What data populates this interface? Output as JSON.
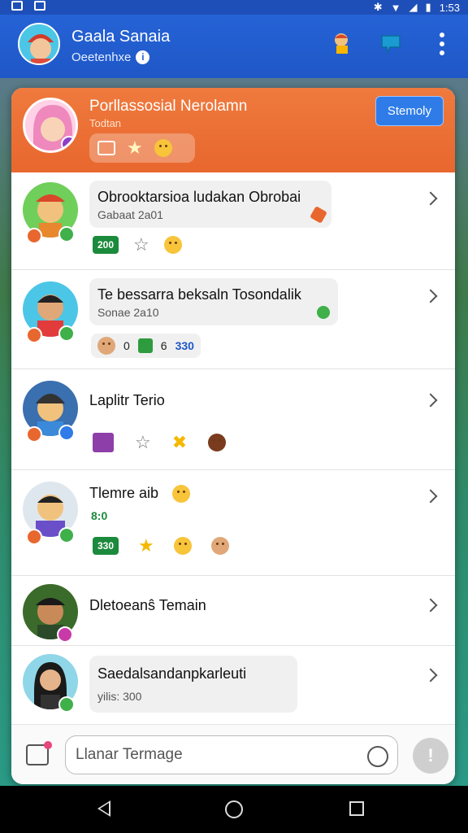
{
  "status_bar": {
    "time": "1:53"
  },
  "app_bar": {
    "title": "Gaala Sanaia",
    "subtitle": "Oeetenhxe",
    "info_glyph": "i",
    "icons": [
      "character-icon",
      "flag-icon",
      "more-vert-icon"
    ]
  },
  "header": {
    "title": "Porllassosial Nerolamn",
    "subtitle": "Todtan",
    "button_label": "Stemoly",
    "chips": [
      "grid-icon",
      "stars-icon",
      "face-icon"
    ]
  },
  "items": [
    {
      "title": "Obrooktarsioa ludakan Obrobai",
      "subtitle": "Gabaat 2a01",
      "chips": [
        "200",
        "star-outline",
        "smile"
      ],
      "has_bubble": true
    },
    {
      "title": "Te bessarra beksaln Tosondalik",
      "subtitle": "Sonae 2a10",
      "chips": [
        "avatar",
        "0",
        "leaf",
        "6",
        "330"
      ],
      "has_bubble": true
    },
    {
      "title": "Laplitr Terio",
      "subtitle": "",
      "chips": [
        "tile",
        "star-outline",
        "star",
        "face"
      ],
      "has_bubble": false
    },
    {
      "title": "Tlemre aib",
      "subtitle": "8:0",
      "chips": [
        "330",
        "star",
        "smile",
        "face"
      ],
      "has_bubble": false
    },
    {
      "title": "Dletoeanŝ Temain",
      "subtitle": "",
      "chips": [],
      "has_bubble": false
    },
    {
      "title": "Saedalsandanpkarleuti",
      "subtitle": "yilis: 300",
      "chips": [],
      "has_bubble": true
    }
  ],
  "input": {
    "placeholder": "Llanar Termage",
    "send_glyph": "!"
  },
  "colors": {
    "app_bar": "#1f57c7",
    "header": "#e8672e",
    "button": "#2f7ce8",
    "pill": "#1c8a3c"
  }
}
